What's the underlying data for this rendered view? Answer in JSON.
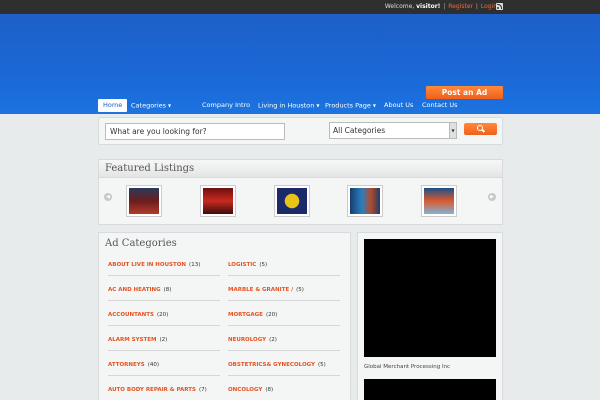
{
  "topbar": {
    "welcome": "Welcome,",
    "user": "visitor!",
    "sep": "|",
    "register": "Register",
    "login": "Login",
    "rss_icon": "rss-icon"
  },
  "header": {
    "post_ad": "Post an Ad"
  },
  "nav": {
    "items": [
      {
        "label": "Home"
      },
      {
        "label": "Categories"
      },
      {
        "label": "Company Intro"
      },
      {
        "label": "Living in Houston"
      },
      {
        "label": "Products Page"
      },
      {
        "label": "About Us"
      },
      {
        "label": "Contact Us"
      }
    ]
  },
  "search": {
    "placeholder": "What are you looking for?",
    "category": "All Categories",
    "button_icon": "search-icon"
  },
  "featured": {
    "title": "Featured Listings",
    "prev_icon": "chevron-left-icon",
    "next_icon": "chevron-right-icon"
  },
  "categories": {
    "title": "Ad Categories",
    "left": [
      {
        "name": "ABOUT LIVE IN HOUSTON",
        "count": "(13)"
      },
      {
        "name": "AC AND HEATING",
        "count": "(8)"
      },
      {
        "name": "ACCOUNTANTS",
        "count": "(20)"
      },
      {
        "name": "ALARM SYSTEM",
        "count": "(2)"
      },
      {
        "name": "ATTORNEYS",
        "count": "(40)"
      },
      {
        "name": "AUTO BODY REPAIR & PARTS",
        "count": "(7)"
      }
    ],
    "right": [
      {
        "name": "LOGISTIC",
        "count": "(5)"
      },
      {
        "name": "MARBLE & GRANITE  /",
        "count": "(5)"
      },
      {
        "name": "MORTGAGE",
        "count": "(20)"
      },
      {
        "name": "NEUROLOGY",
        "count": "(2)"
      },
      {
        "name": "OBSTETRICS& GYNECOLOGY",
        "count": "(5)"
      },
      {
        "name": "ONCOLOGY",
        "count": "(8)"
      }
    ]
  },
  "sidebar": {
    "video_caption": "Global Merchant Processing Inc"
  }
}
